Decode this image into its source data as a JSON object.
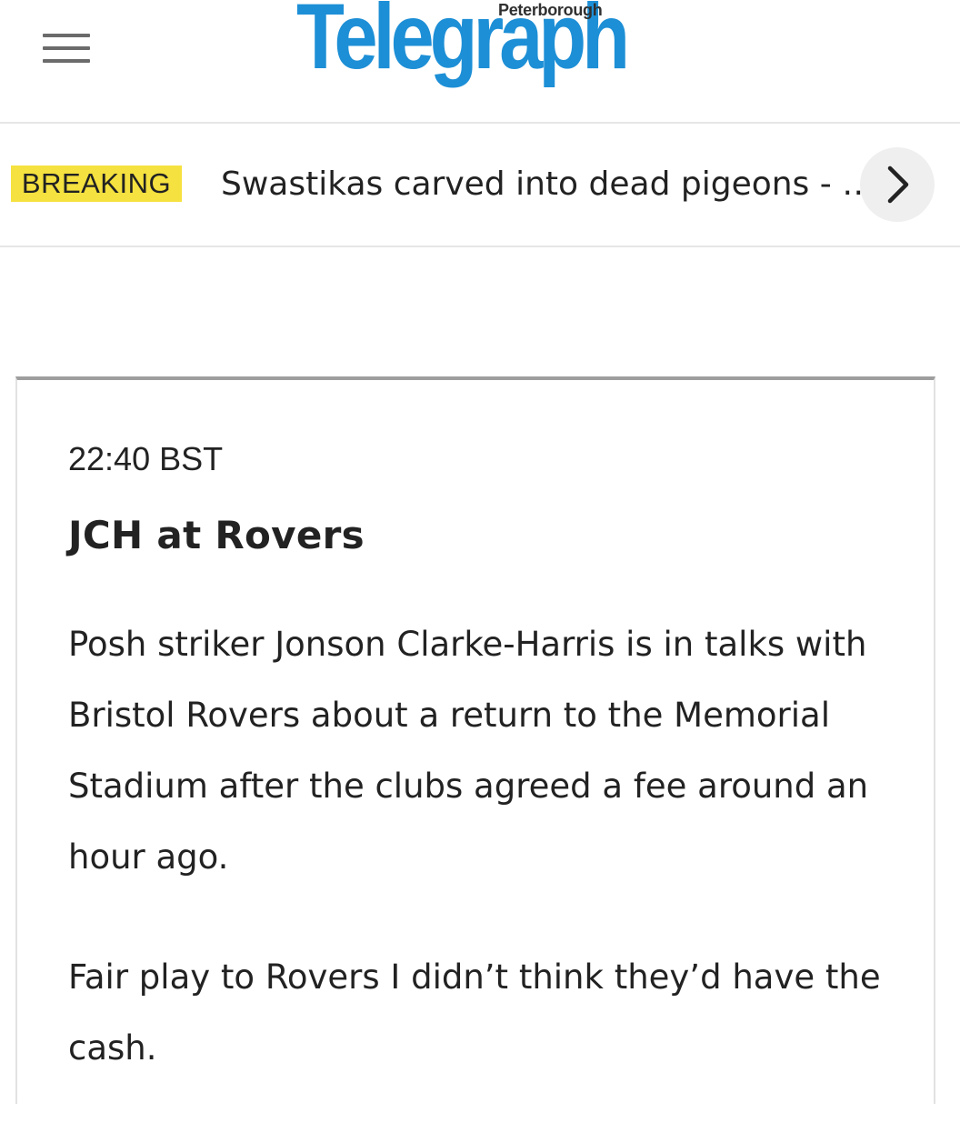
{
  "header": {
    "menu_icon": "hamburger-menu-icon",
    "logo_sub": "Peterborough",
    "logo_main": "Telegraph",
    "brand_color": "#1d8fd6"
  },
  "breaking": {
    "badge": "BREAKING",
    "badge_color": "#f5e13f",
    "headline": "Swastikas carved into dead pigeons - police investigate",
    "next_icon": "chevron-right-icon"
  },
  "post": {
    "time": "22:40 BST",
    "title": "JCH at Rovers",
    "paragraphs": [
      "Posh striker Jonson Clarke-Harris is in talks with Bristol Rovers about a return to the Memorial Stadium after the clubs agreed a fee around an hour ago.",
      "Fair play to Rovers I didn’t think they’d have the cash."
    ]
  }
}
